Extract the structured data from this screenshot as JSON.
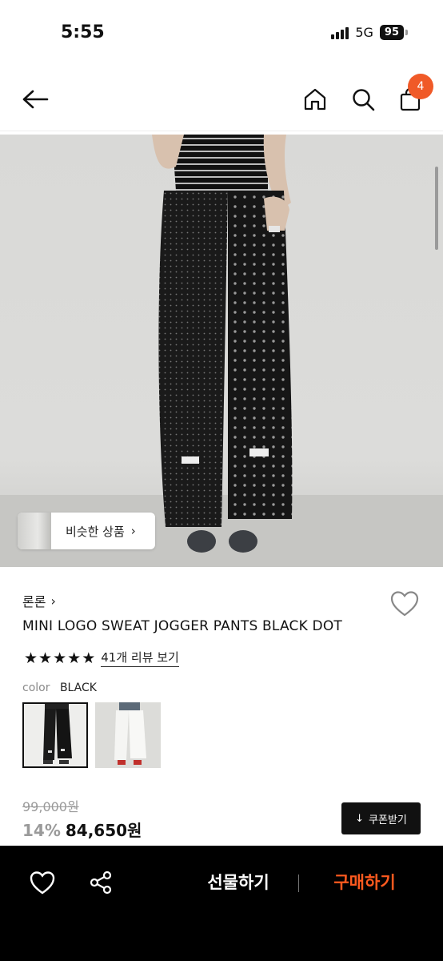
{
  "status_bar": {
    "time": "5:55",
    "network": "5G",
    "battery": "95"
  },
  "header": {
    "icons": [
      "back-arrow-icon",
      "home-icon",
      "search-icon",
      "shopping-bag-icon"
    ],
    "cart_count": "4",
    "badge_color": "#f05a28"
  },
  "gallery": {
    "similar_label": "비슷한 상품",
    "similar_chevron": "›"
  },
  "product": {
    "brand": "론론",
    "brand_chevron": "›",
    "title": "MINI LOGO SWEAT JOGGER PANTS BLACK DOT",
    "rating": 5,
    "stars": [
      "★",
      "★",
      "★",
      "★",
      "★"
    ],
    "review_link": "41개 리뷰 보기",
    "color_label": "color",
    "color_value": "BLACK",
    "color_options": [
      "black-dot",
      "white"
    ],
    "original_price": "99,000원",
    "discount": "14%",
    "sale_price": "84,650원",
    "coupon_label": "쿠폰받기",
    "coupon_icon": "↓"
  },
  "bottom_bar": {
    "gift_label": "선물하기",
    "buy_label": "구매하기",
    "buy_color": "#ff5a1f",
    "icons": [
      "heart-icon",
      "share-icon"
    ]
  }
}
